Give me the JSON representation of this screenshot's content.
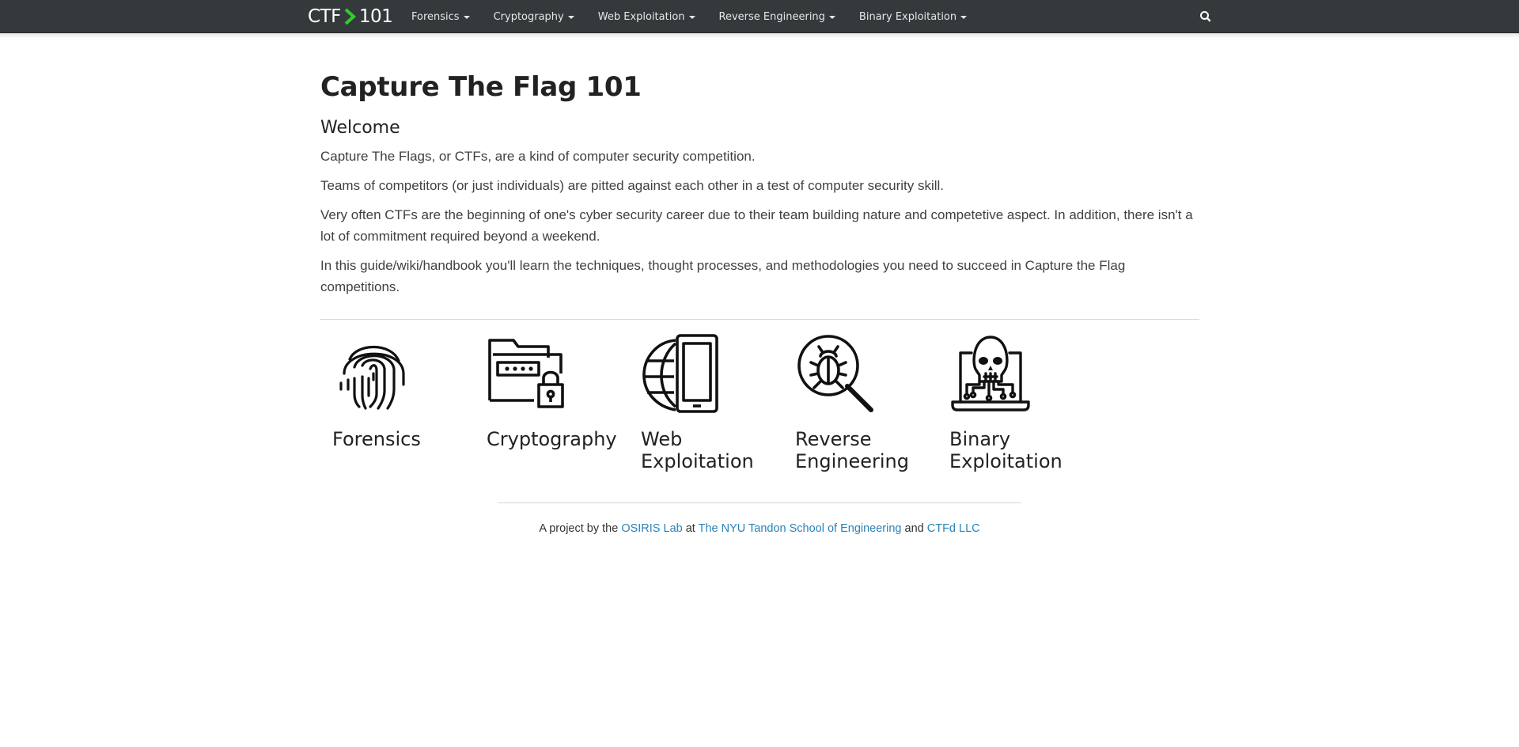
{
  "nav": {
    "brand": {
      "left": "CTF",
      "right": "101"
    },
    "items": [
      {
        "label": "Forensics"
      },
      {
        "label": "Cryptography"
      },
      {
        "label": "Web Exploitation"
      },
      {
        "label": "Reverse Engineering"
      },
      {
        "label": "Binary Exploitation"
      }
    ],
    "search_icon": "search-icon"
  },
  "main": {
    "title": "Capture The Flag 101",
    "subtitle": "Welcome",
    "paragraphs": [
      "Capture The Flags, or CTFs, are a kind of computer security competition.",
      "Teams of competitors (or just individuals) are pitted against each other in a test of computer security skill.",
      "Very often CTFs are the beginning of one's cyber security career due to their team building nature and competetive aspect. In addition, there isn't a lot of commitment required beyond a weekend.",
      "In this guide/wiki/handbook you'll learn the techniques, thought processes, and methodologies you need to succeed in Capture the Flag competitions."
    ]
  },
  "topics": [
    {
      "label": "Forensics",
      "icon": "fingerprint-icon"
    },
    {
      "label": "Cryptography",
      "icon": "locked-folder-icon"
    },
    {
      "label": "Web Exploitation",
      "icon": "globe-phone-icon"
    },
    {
      "label": "Reverse Engineering",
      "icon": "bug-magnifier-icon"
    },
    {
      "label": "Binary Exploitation",
      "icon": "skull-laptop-icon"
    }
  ],
  "footer": {
    "prefix": "A project by the",
    "link1": "OSIRIS Lab",
    "at": "at",
    "link2": "The NYU Tandon School of Engineering",
    "and": "and",
    "link3": "CTFd LLC"
  },
  "colors": {
    "navbar": "#343a3c",
    "brand_arrow": "#2bd02b",
    "link": "#2a83b8"
  }
}
